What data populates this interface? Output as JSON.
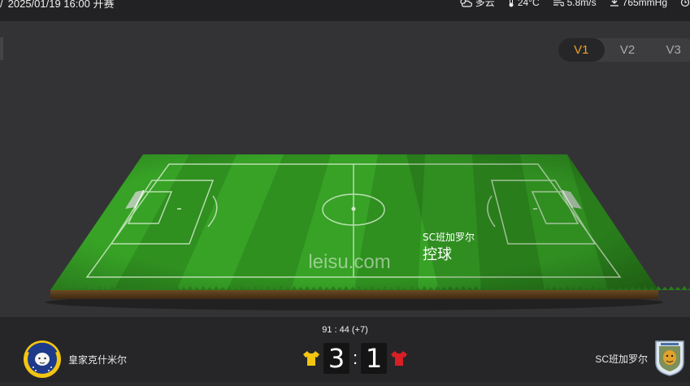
{
  "header": {
    "datetime": "2025/01/19 16:00 开赛",
    "weather": {
      "condition": "多云",
      "temperature": "24°C",
      "wind": "5.8m/s",
      "pressure": "765mmHg"
    }
  },
  "view_tabs": [
    "V1",
    "V2",
    "V3"
  ],
  "active_tab": "V1",
  "pitch": {
    "watermark": "leisu.com",
    "possession_team": "SC班加罗尔",
    "possession_label": "控球"
  },
  "match": {
    "time": "91 : 44  (+7)",
    "home": {
      "name": "皇家克什米尔",
      "score": "3",
      "shirt_color": "#f2c511"
    },
    "away": {
      "name": "SC班加罗尔",
      "score": "1",
      "shirt_color": "#d81f26"
    },
    "separator": ":"
  },
  "colors": {
    "accent": "#f0a020",
    "pitch_green": "#2f8f1f"
  }
}
